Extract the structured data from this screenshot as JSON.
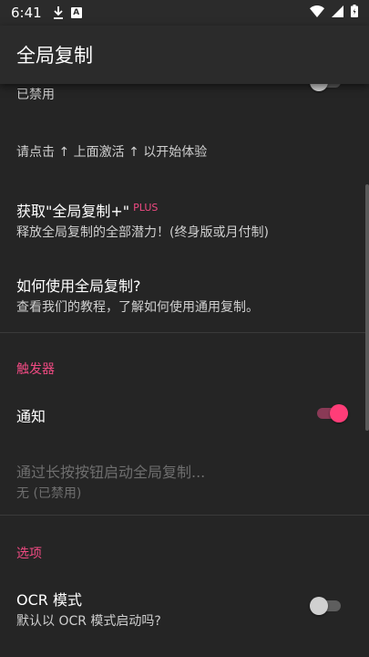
{
  "status_bar": {
    "time": "6:41",
    "icons": [
      "download-icon",
      "a-badge-icon",
      "wifi-icon",
      "signal-icon",
      "battery-icon"
    ],
    "a_badge": "A"
  },
  "app_bar": {
    "title": "全局复制"
  },
  "settings": {
    "master_toggle": {
      "label": "已禁用",
      "enabled": false
    },
    "hint": {
      "text": "请点击 ↑ 上面激活 ↑ 以开始体验"
    },
    "get_plus": {
      "title": "获取\"全局复制+\"",
      "badge": "PLUS",
      "subtitle": "释放全局复制的全部潜力！(终身版或月付制)"
    },
    "how_to": {
      "title": "如何使用全局复制?",
      "subtitle": "查看我们的教程，了解如何使用通用复制。"
    },
    "triggers": {
      "header": "触发器",
      "notification": {
        "label": "通知",
        "enabled": true
      },
      "long_press": {
        "title": "通过长按按钮启动全局复制...",
        "subtitle": "无 (已禁用)"
      }
    },
    "options": {
      "header": "选项",
      "ocr_mode": {
        "title": "OCR 模式",
        "subtitle": "默认以 OCR 模式启动吗?",
        "enabled": false
      }
    }
  },
  "colors": {
    "accent": "#ef4a82",
    "background": "#252525",
    "bar": "#2b2b2b"
  }
}
